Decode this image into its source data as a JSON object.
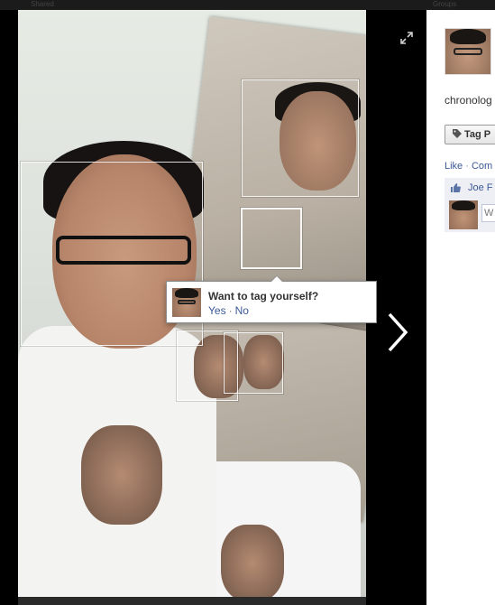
{
  "topbar": {
    "left_text": "Shared",
    "right_text": "Groups"
  },
  "viewer": {
    "expand_icon": "expand-icon",
    "next_icon": "chevron-right-icon",
    "tag_prompt": {
      "question": "Want to tag yourself?",
      "yes_label": "Yes",
      "separator": "·",
      "no_label": "No"
    }
  },
  "sidebar": {
    "caption": "chronolog",
    "tag_button_label": "Tag P",
    "tag_icon": "tag-icon",
    "actions": {
      "like": "Like",
      "separator": "·",
      "comment": "Com"
    },
    "likes": {
      "thumb_icon": "thumbs-up-icon",
      "liker": "Joe F"
    },
    "comment_placeholder": "W"
  },
  "colors": {
    "link": "#3b5998",
    "like_box": "#edeff4"
  }
}
